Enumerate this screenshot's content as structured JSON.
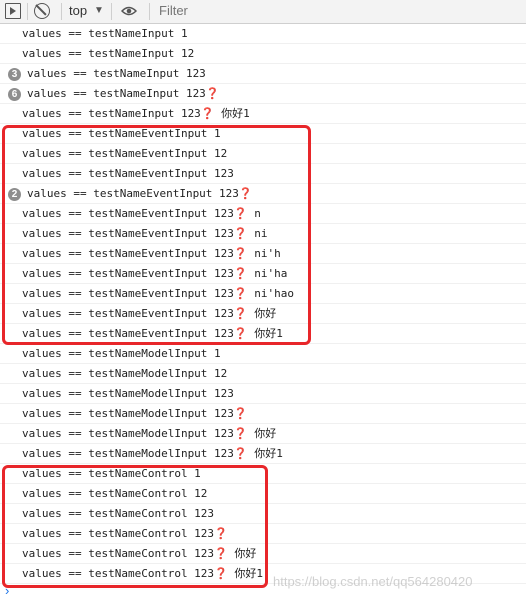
{
  "toolbar": {
    "context_label": "top",
    "filter_placeholder": "Filter",
    "caret": "▼"
  },
  "console_rows": [
    {
      "text": "values == testNameInput 1",
      "count": ""
    },
    {
      "text": "values == testNameInput 12",
      "count": ""
    },
    {
      "text": "values == testNameInput 123",
      "count": "3"
    },
    {
      "text": "values == testNameInput 123❓",
      "count": "6"
    },
    {
      "text": "values == testNameInput 123❓ 你好1",
      "count": ""
    },
    {
      "text": "values == testNameEventInput 1",
      "count": ""
    },
    {
      "text": "values == testNameEventInput 12",
      "count": ""
    },
    {
      "text": "values == testNameEventInput 123",
      "count": ""
    },
    {
      "text": "values == testNameEventInput 123❓",
      "count": "2"
    },
    {
      "text": "values == testNameEventInput 123❓ n",
      "count": ""
    },
    {
      "text": "values == testNameEventInput 123❓ ni",
      "count": ""
    },
    {
      "text": "values == testNameEventInput 123❓ ni'h",
      "count": ""
    },
    {
      "text": "values == testNameEventInput 123❓ ni'ha",
      "count": ""
    },
    {
      "text": "values == testNameEventInput 123❓ ni'hao",
      "count": ""
    },
    {
      "text": "values == testNameEventInput 123❓ 你好",
      "count": ""
    },
    {
      "text": "values == testNameEventInput 123❓ 你好1",
      "count": ""
    },
    {
      "text": "values == testNameModelInput 1",
      "count": ""
    },
    {
      "text": "values == testNameModelInput 12",
      "count": ""
    },
    {
      "text": "values == testNameModelInput 123",
      "count": ""
    },
    {
      "text": "values == testNameModelInput 123❓",
      "count": ""
    },
    {
      "text": "values == testNameModelInput 123❓ 你好",
      "count": ""
    },
    {
      "text": "values == testNameModelInput 123❓ 你好1",
      "count": ""
    },
    {
      "text": "values == testNameControl 1",
      "count": ""
    },
    {
      "text": "values == testNameControl 12",
      "count": ""
    },
    {
      "text": "values == testNameControl 123",
      "count": ""
    },
    {
      "text": "values == testNameControl 123❓",
      "count": ""
    },
    {
      "text": "values == testNameControl 123❓ 你好",
      "count": ""
    },
    {
      "text": "values == testNameControl 123❓ 你好1",
      "count": ""
    }
  ],
  "prompt_symbol": "›",
  "watermark": "https://blog.csdn.net/qq564280420",
  "colors": {
    "highlight_border": "#e8262a",
    "count_badge": "#8e8e8e",
    "prompt": "#1a73e8"
  }
}
